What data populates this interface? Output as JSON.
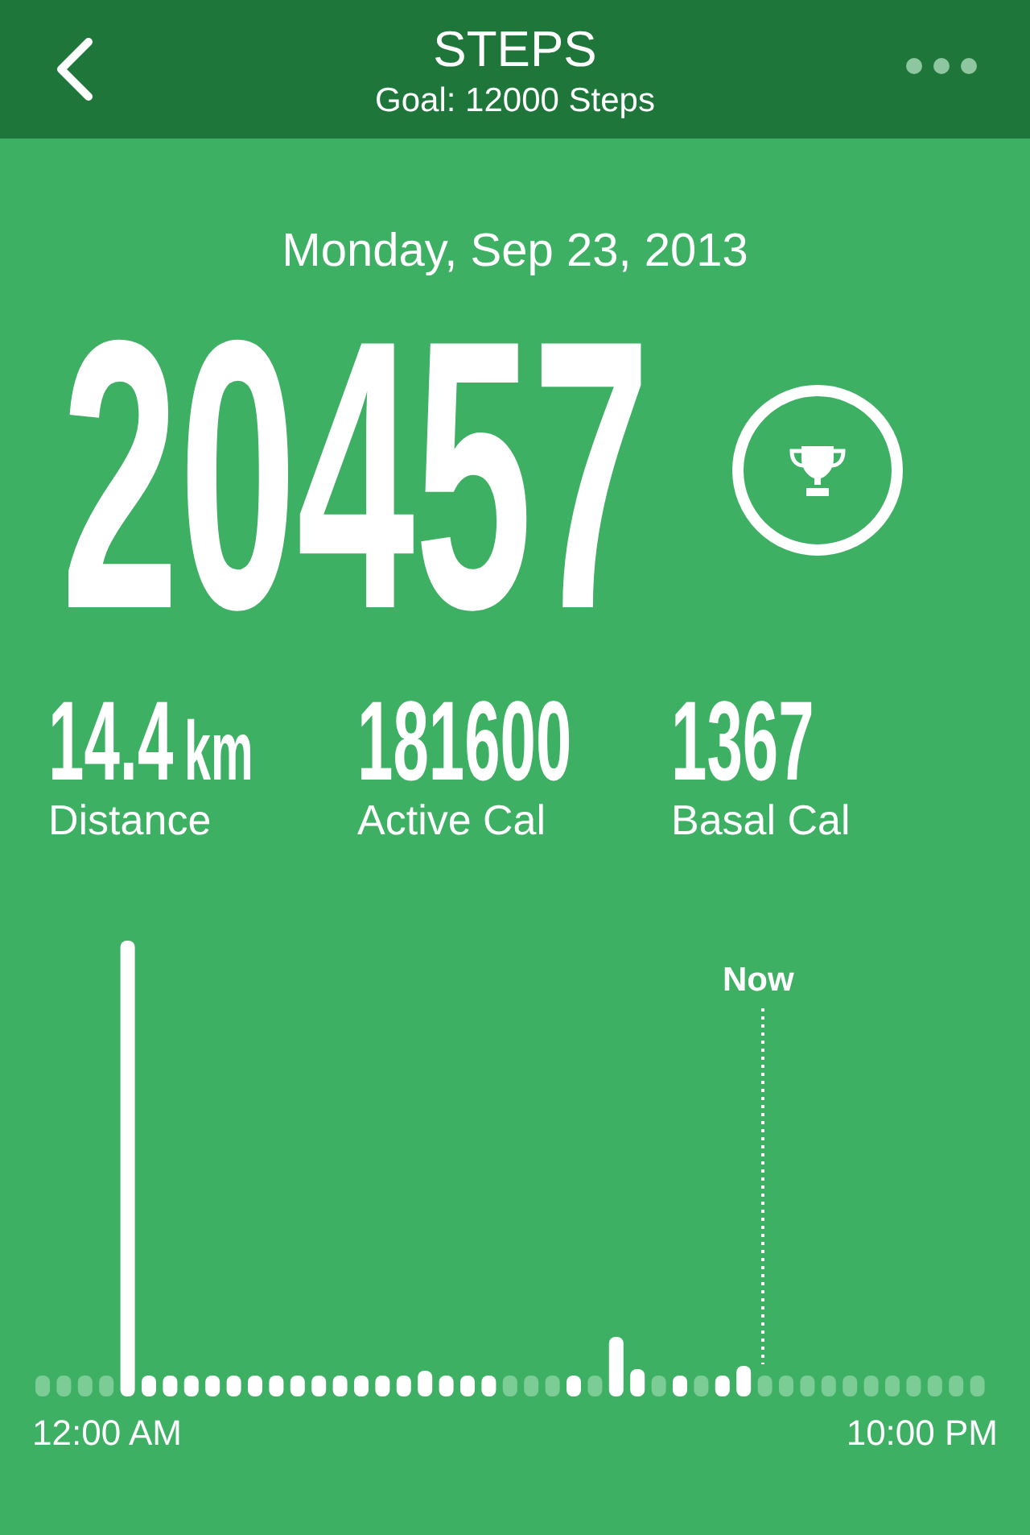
{
  "header": {
    "title": "STEPS",
    "subtitle": "Goal: 12000 Steps"
  },
  "date": "Monday, Sep 23, 2013",
  "steps": "20457",
  "stats": [
    {
      "value": "14.4",
      "unit": "km",
      "label": "Distance"
    },
    {
      "value": "181600",
      "label": "Active Cal"
    },
    {
      "value": "1367",
      "label": "Basal Cal"
    }
  ],
  "chart": {
    "now_label": "Now",
    "axis_start": "12:00 AM",
    "axis_end": "10:00 PM"
  }
}
